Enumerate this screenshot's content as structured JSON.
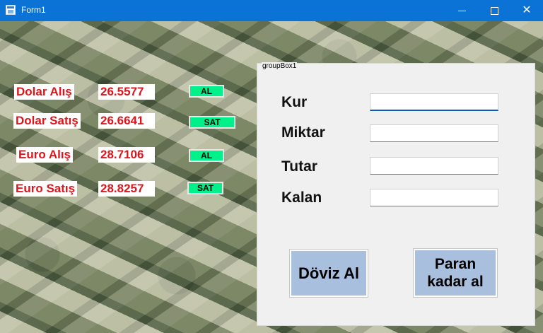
{
  "window": {
    "title": "Form1"
  },
  "rates": [
    {
      "label": "Dolar Alış",
      "value": "26.5577",
      "button": "AL"
    },
    {
      "label": "Dolar Satış",
      "value": "26.6641",
      "button": "SAT"
    },
    {
      "label": "Euro Alış",
      "value": "28.7106",
      "button": "AL"
    },
    {
      "label": "Euro Satış",
      "value": "28.8257",
      "button": "SAT"
    }
  ],
  "groupbox": {
    "caption": "groupBox1",
    "fields": {
      "kur": "Kur",
      "miktar": "Miktar",
      "tutar": "Tutar",
      "kalan": "Kalan"
    },
    "values": {
      "kur": "",
      "miktar": "",
      "tutar": "",
      "kalan": ""
    },
    "buttons": {
      "doviz_al": "Döviz Al",
      "paran_line1": "Paran",
      "paran_line2": "kadar al"
    }
  },
  "colors": {
    "titlebar": "#0b72d6",
    "rate_text": "#e0151b",
    "green_button": "#00f08a",
    "big_button": "#a9bfde"
  }
}
